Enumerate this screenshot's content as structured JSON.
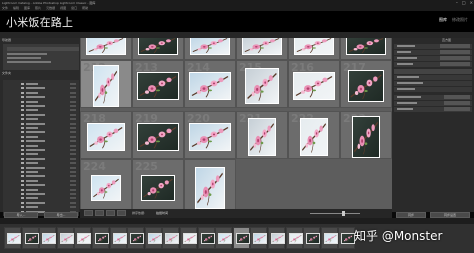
{
  "window": {
    "title": "Lightroom Catalog - Adobe Photoshop Lightroom Classic - 图库",
    "controls": [
      "–",
      "□",
      "×"
    ]
  },
  "menu": [
    "文件",
    "编辑",
    "图库",
    "照片",
    "元数据",
    "视图",
    "窗口",
    "帮助"
  ],
  "identity_plate": {
    "text": "小米饭在路上",
    "modules": [
      "图库",
      "修改照片"
    ],
    "active_module": "图库"
  },
  "left_panel": {
    "sections": [
      "导航器",
      "目录",
      "文件夹",
      "收藏夹",
      "发布服务"
    ],
    "buttons": {
      "import": "导入...",
      "export": "导出..."
    }
  },
  "right_panel": {
    "sections": [
      "直方图",
      "快速修改照片",
      "关键字",
      "关键字列表",
      "元数据",
      "评论"
    ],
    "buttons": {
      "sync": "同步",
      "sync_settings": "同步设置"
    }
  },
  "grid": {
    "cell_numbers": [
      "",
      "",
      "",
      "",
      "",
      "",
      "212",
      "213",
      "214",
      "215",
      "216",
      "217",
      "218",
      "219",
      "220",
      "221",
      "222",
      "223",
      "224",
      "225"
    ]
  },
  "toolbar": {
    "sort_label": "排序依据:",
    "sort_value": "拍摄时间"
  },
  "filmstrip": {
    "count": 20
  },
  "watermark": {
    "text": "知乎 @Monster"
  },
  "colors": {
    "panel": "#2a2a2a",
    "grid": "#5d5d5d",
    "blossom": "#e48bb0",
    "sky": "#b8d8ec"
  }
}
